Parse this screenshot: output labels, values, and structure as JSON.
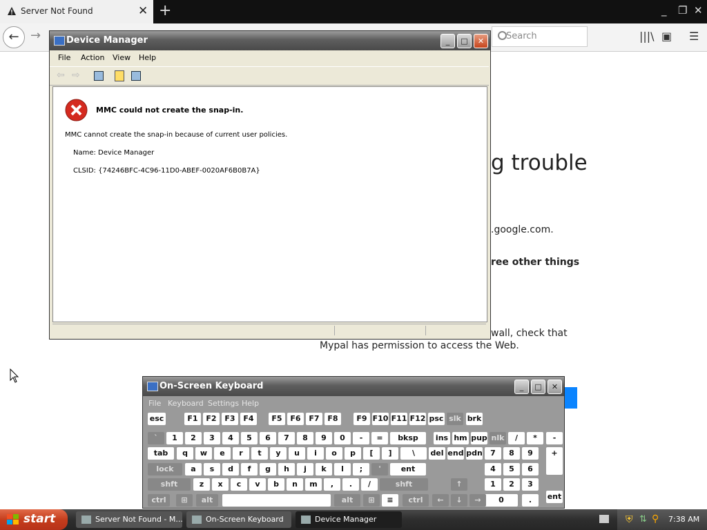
{
  "browser": {
    "tab_title": "Server Not Found",
    "search_placeholder": "Search",
    "page": {
      "heading_fragment": "g trouble",
      "line1_fragment": ".google.com.",
      "line2_fragment": "ree other things",
      "line3_fragment": "wall, check that",
      "line4": "Mypal has permission to access the Web."
    }
  },
  "device_manager": {
    "title": "Device Manager",
    "menu": [
      "File",
      "Action",
      "View",
      "Help"
    ],
    "error_title": "MMC could not create the snap-in.",
    "error_message": "MMC cannot create the snap-in because of current user policies.",
    "name_line": "Name: Device Manager",
    "clsid_line": "CLSID: {74246BFC-4C96-11D0-ABEF-0020AF6B0B7A}"
  },
  "osk": {
    "title": "On-Screen Keyboard",
    "menu": [
      "File",
      "Keyboard",
      "Settings",
      "Help"
    ],
    "row1": [
      "esc",
      "F1",
      "F2",
      "F3",
      "F4",
      "F5",
      "F6",
      "F7",
      "F8",
      "F9",
      "F10",
      "F11",
      "F12",
      "psc",
      "slk",
      "brk"
    ],
    "row2": [
      "`",
      "1",
      "2",
      "3",
      "4",
      "5",
      "6",
      "7",
      "8",
      "9",
      "0",
      "-",
      "=",
      "bksp",
      "ins",
      "hm",
      "pup",
      "nlk",
      "/",
      "*",
      "-"
    ],
    "row3": [
      "tab",
      "q",
      "w",
      "e",
      "r",
      "t",
      "y",
      "u",
      "i",
      "o",
      "p",
      "[",
      "]",
      "\\",
      "del",
      "end",
      "pdn",
      "7",
      "8",
      "9",
      "+"
    ],
    "row4": [
      "lock",
      "a",
      "s",
      "d",
      "f",
      "g",
      "h",
      "j",
      "k",
      "l",
      ";",
      "'",
      "ent",
      "4",
      "5",
      "6"
    ],
    "row5": [
      "shft",
      "z",
      "x",
      "c",
      "v",
      "b",
      "n",
      "m",
      ",",
      ".",
      "/",
      "shft",
      "1",
      "2",
      "3",
      "ent"
    ],
    "row6": [
      "ctrl",
      "alt",
      "alt",
      "ctrl",
      "0",
      "."
    ]
  },
  "taskbar": {
    "start_label": "start",
    "tasks": [
      "Server Not Found - M...",
      "On-Screen Keyboard",
      "Device Manager"
    ],
    "clock": "7:38 AM"
  }
}
